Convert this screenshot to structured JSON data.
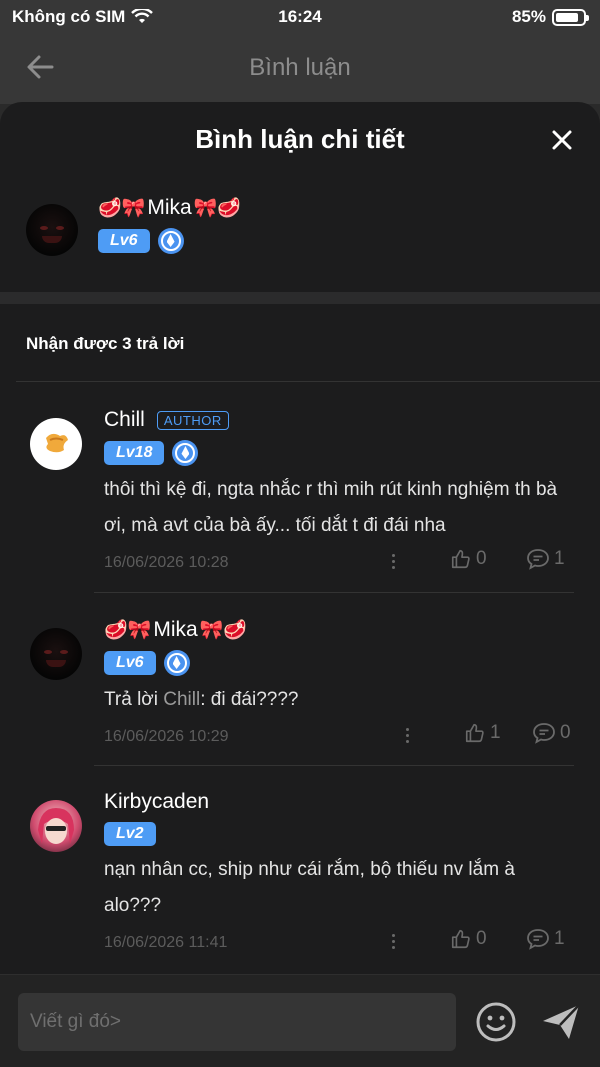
{
  "status_bar": {
    "carrier": "Không có SIM",
    "time": "16:24",
    "battery": "85%",
    "battery_level": 0.85
  },
  "navbar": {
    "title": "Bình luận"
  },
  "sheet": {
    "title": "Bình luận chi tiết"
  },
  "root_comment": {
    "user": {
      "prefix_emoji": "🥩🎀",
      "name": "Mika",
      "suffix_emoji": "🎀🥩",
      "level": "Lv6"
    }
  },
  "replies_header": "Nhận được 3 trả lời",
  "replies": [
    {
      "user": {
        "name": "Chill",
        "tag": "AUTHOR",
        "level": "Lv18"
      },
      "text": "thôi thì kệ đi, ngta nhắc r thì mih rút kinh nghiệm th bà ơi, mà avt của bà ấy... tối dắt t đi đái nha",
      "time": "16/06/2026 10:28",
      "likes": "0",
      "comments": "1"
    },
    {
      "user": {
        "prefix_emoji": "🥩🎀",
        "name": "Mika",
        "suffix_emoji": "🎀🥩",
        "level": "Lv6"
      },
      "reply_prefix": "Trả lời ",
      "reply_to": "Chill",
      "text": ": đi đái????",
      "time": "16/06/2026 10:29",
      "likes": "1",
      "comments": "0"
    },
    {
      "user": {
        "name": "Kirbycaden",
        "level": "Lv2"
      },
      "text": "nạn nhân cc, ship như cái rắm, bộ thiếu nv lắm à alo???",
      "time": "16/06/2026 11:41",
      "likes": "0",
      "comments": "1"
    }
  ],
  "input": {
    "placeholder": "Viết gì đó>"
  },
  "icons": {
    "back": "arrow-left-icon",
    "close": "close-icon",
    "vip": "shield-badge-icon",
    "more": "more-vertical-icon",
    "like": "thumbs-up-icon",
    "comment": "comment-icon",
    "emoji": "smiley-icon",
    "send": "send-icon"
  },
  "colors": {
    "accent": "#4e9cf5",
    "background": "#1c1c1d"
  }
}
